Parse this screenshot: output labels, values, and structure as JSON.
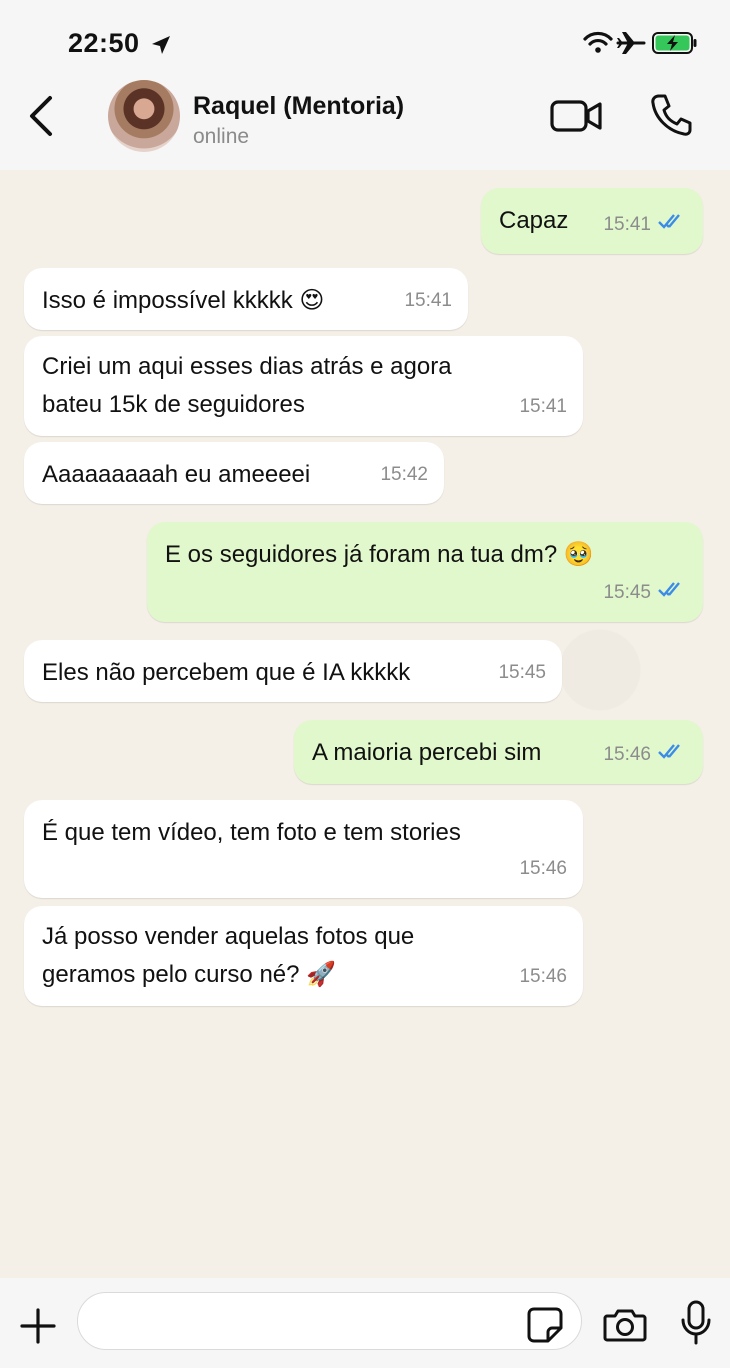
{
  "status_bar": {
    "time": "22:50",
    "icons": [
      "location-arrow-icon",
      "wifi-icon",
      "airplane-icon",
      "battery-charging-icon"
    ]
  },
  "header": {
    "contact_name": "Raquel (Mentoria)",
    "status": "online"
  },
  "messages": [
    {
      "direction": "out",
      "text": "Capaz",
      "time": "15:41",
      "read": true
    },
    {
      "direction": "in",
      "text": "Isso é impossível kkkkk 😍",
      "time": "15:41"
    },
    {
      "direction": "in",
      "lines": [
        "Criei um aqui esses dias atrás e agora",
        "bateu 15k de seguidores"
      ],
      "time": "15:41"
    },
    {
      "direction": "in",
      "text": "Aaaaaaaaah eu ameeeei",
      "time": "15:42"
    },
    {
      "direction": "out",
      "text": "E os seguidores já foram na tua dm? 🥹",
      "time": "15:45",
      "read": true
    },
    {
      "direction": "in",
      "text": "Eles não percebem que é IA kkkkk",
      "time": "15:45"
    },
    {
      "direction": "out",
      "text": "A maioria percebi sim",
      "time": "15:46",
      "read": true
    },
    {
      "direction": "in",
      "text": "É que tem vídeo, tem foto e tem stories",
      "time": "15:46"
    },
    {
      "direction": "in",
      "lines": [
        "Já posso vender aquelas fotos que",
        "geramos pelo curso né? 🚀"
      ],
      "time": "15:46"
    }
  ],
  "colors": {
    "outgoing_bubble": "#E1F8CC",
    "incoming_bubble": "#FFFFFF",
    "read_ticks": "#3B8CE8",
    "chat_background": "#F4EFE7"
  }
}
